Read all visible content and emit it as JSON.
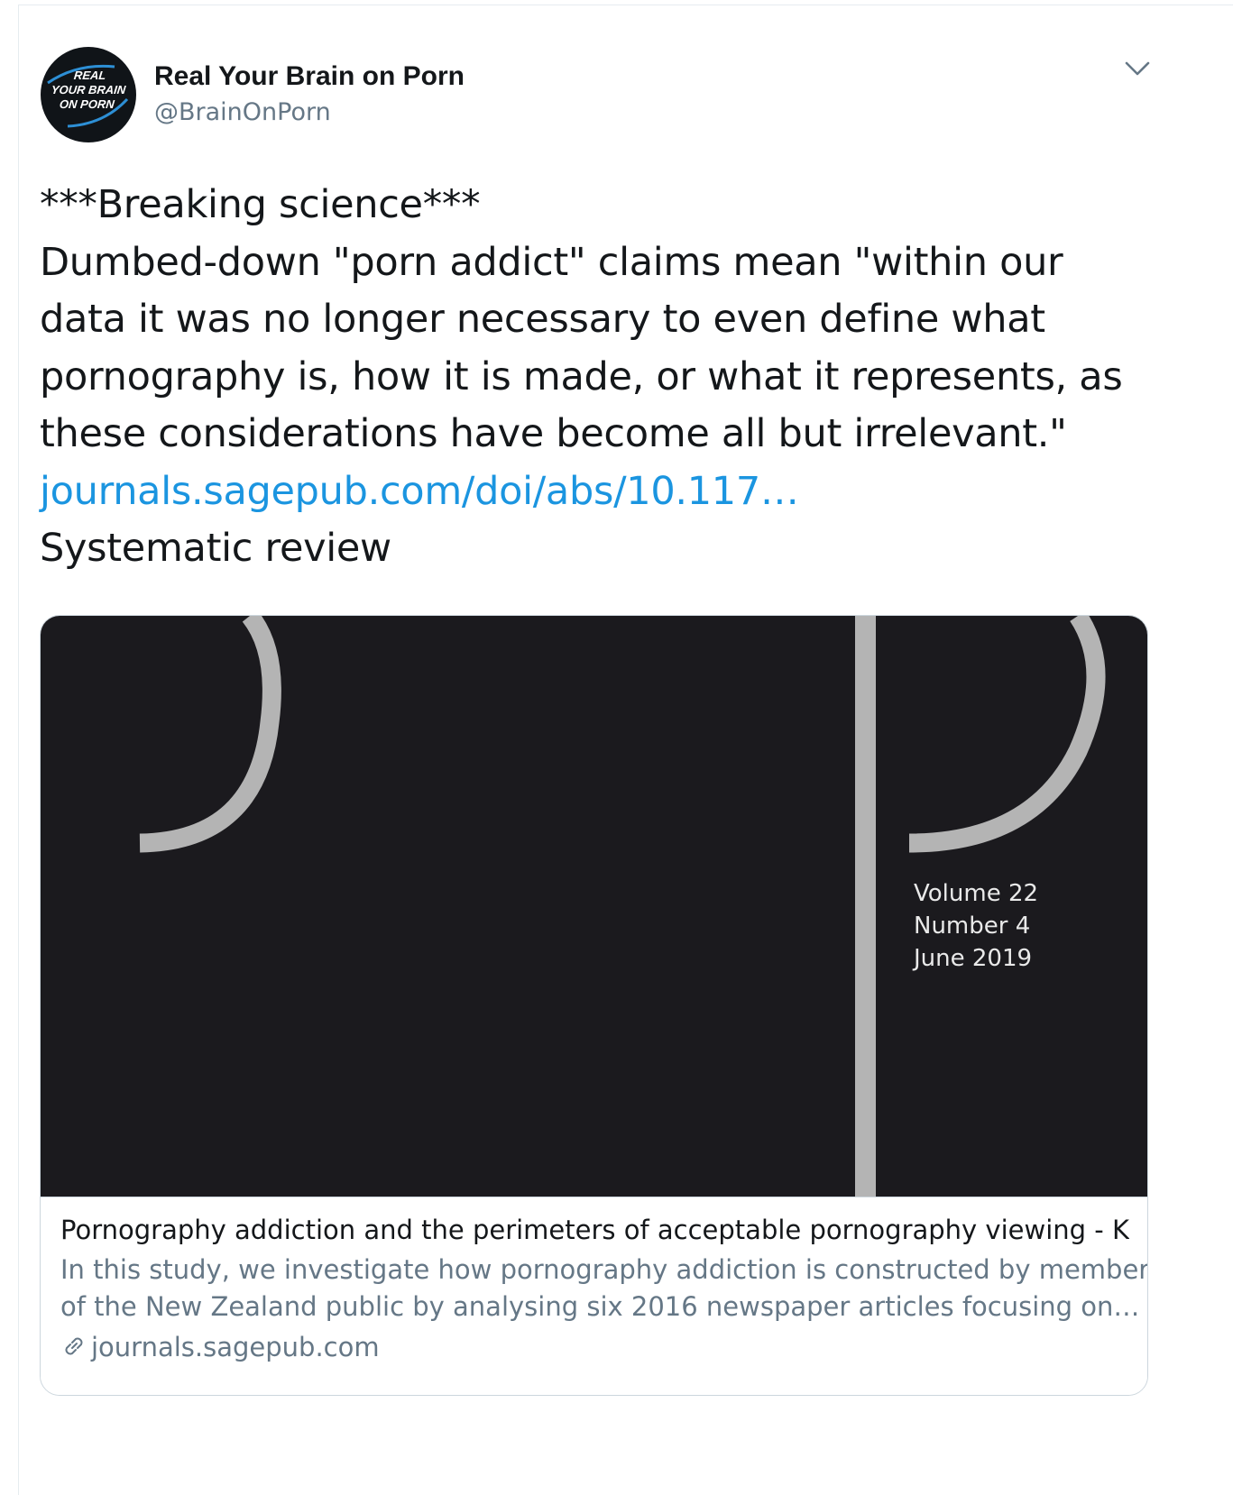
{
  "author": {
    "display_name": "Real Your Brain on Porn",
    "handle": "@BrainOnPorn",
    "avatar_lines": [
      "REAL",
      "YOUR BRAIN",
      "ON PORN"
    ]
  },
  "tweet": {
    "lines": [
      "***Breaking science***",
      "Dumbed-down \"porn addict\" claims mean \"within our",
      "data it was no longer necessary to even define what",
      "pornography is, how it is made, or what it represents, as",
      "these considerations have become all but irrelevant.\""
    ],
    "link_text": "journals.sagepub.com/doi/abs/10.117…",
    "after_link": "Systematic review"
  },
  "card": {
    "cover": {
      "volume": "Volume 22",
      "number": "Number 4",
      "date": "June 2019"
    },
    "title": "Pornography addiction and the perimeters of acceptable pornography viewing - K…",
    "description_lines": [
      "In this study, we investigate how pornography addiction is constructed by members",
      "of the New Zealand public by analysing six 2016 newspaper articles focusing on…"
    ],
    "domain": "journals.sagepub.com"
  },
  "icons": {
    "more": "chevron-down-icon",
    "link": "link-icon"
  },
  "colors": {
    "link": "#1b95e0",
    "secondary_text": "#657786",
    "cover_background": "#1b1a1e",
    "cover_stroke": "#b4b4b4"
  }
}
